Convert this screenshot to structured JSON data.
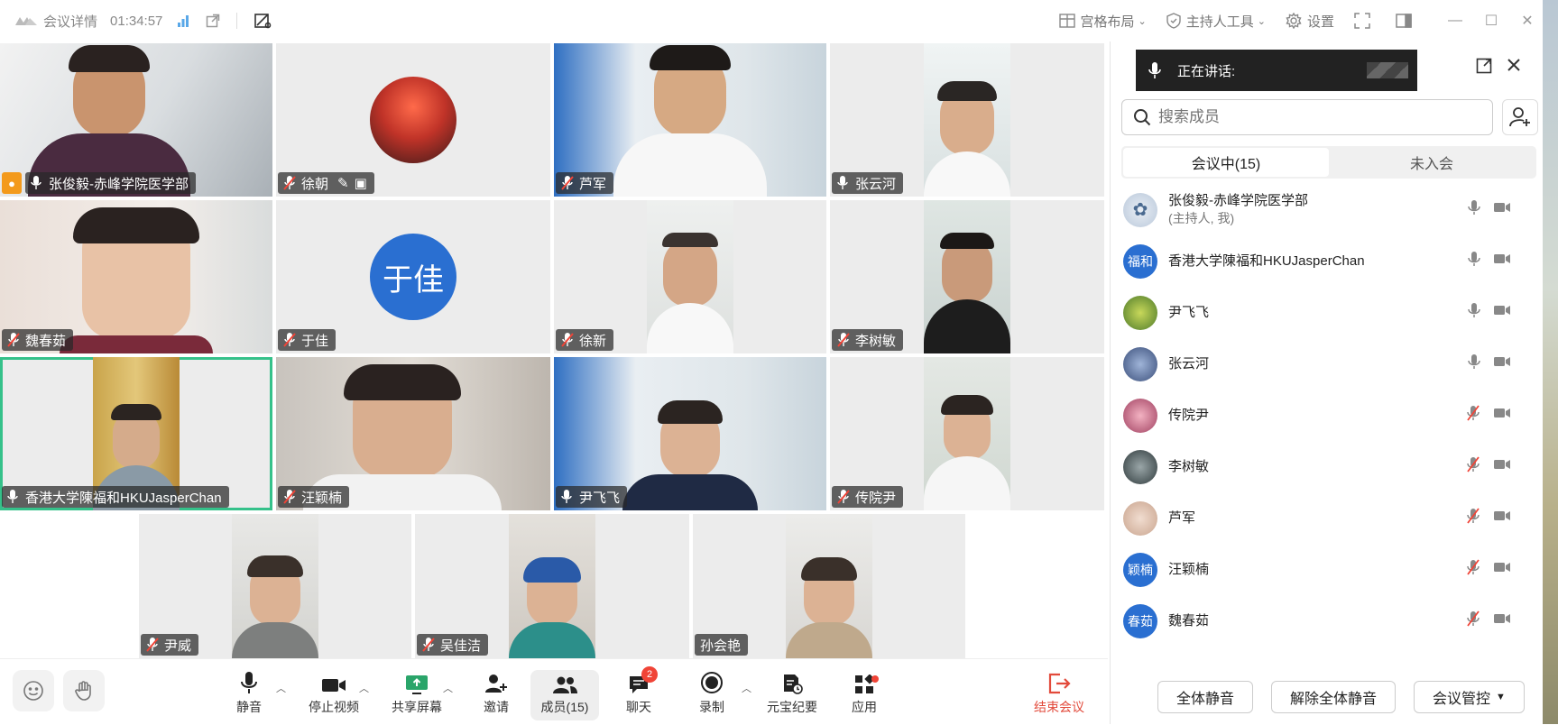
{
  "window": {
    "meeting_details": "会议详情",
    "elapsed_time": "01:34:57",
    "layout_label": "宫格布局",
    "host_tools_label": "主持人工具",
    "settings_label": "设置"
  },
  "tiles": [
    {
      "name": "张俊毅-赤峰学院医学部",
      "host": true
    },
    {
      "name": "徐朝"
    },
    {
      "name": "芦军"
    },
    {
      "name": "张云河"
    },
    {
      "name": "魏春茹"
    },
    {
      "name": "于佳",
      "avatar_text": "于佳"
    },
    {
      "name": "徐新"
    },
    {
      "name": "李树敏"
    },
    {
      "name": "香港大学陳福和HKUJasperChan",
      "active": true
    },
    {
      "name": "汪颖楠"
    },
    {
      "name": "尹飞飞"
    },
    {
      "name": "传院尹"
    },
    {
      "name": "尹威"
    },
    {
      "name": "吴佳洁"
    },
    {
      "name": "孙会艳"
    }
  ],
  "toolbar": {
    "mute": "静音",
    "stop_video": "停止视频",
    "share_screen": "共享屏幕",
    "invite": "邀请",
    "members": "成员(15)",
    "chat": "聊天",
    "chat_badge": "2",
    "record": "录制",
    "yuanbao_minutes": "元宝纪要",
    "apps": "应用",
    "end_meeting": "结束会议"
  },
  "panel": {
    "speaking_label": "正在讲话:",
    "search_placeholder": "搜索成员",
    "tab_in_meeting": "会议中(15)",
    "tab_not_joined": "未入会",
    "members": [
      {
        "name": "张俊毅-赤峰学院医学部",
        "sub": "(主持人, 我)",
        "avatar": "",
        "mic_muted": false
      },
      {
        "name": "香港大学陳福和HKUJasperChan",
        "avatar": "福和",
        "mic_muted": false
      },
      {
        "name": "尹飞飞",
        "avatar": "",
        "mic_muted": false
      },
      {
        "name": "张云河",
        "avatar": "",
        "mic_muted": false
      },
      {
        "name": "传院尹",
        "avatar": "",
        "mic_muted": true
      },
      {
        "name": "李树敏",
        "avatar": "",
        "mic_muted": true
      },
      {
        "name": "芦军",
        "avatar": "",
        "mic_muted": true
      },
      {
        "name": "汪颖楠",
        "avatar": "颖楠",
        "mic_muted": true
      },
      {
        "name": "魏春茹",
        "avatar": "春茹",
        "mic_muted": true
      }
    ],
    "mute_all": "全体静音",
    "unmute_all": "解除全体静音",
    "meeting_control": "会议管控"
  },
  "colors": {
    "accent_blue": "#2a6fd1",
    "active_green": "#35c18a",
    "alert_red": "#f04437",
    "host_orange": "#f39a1c"
  }
}
